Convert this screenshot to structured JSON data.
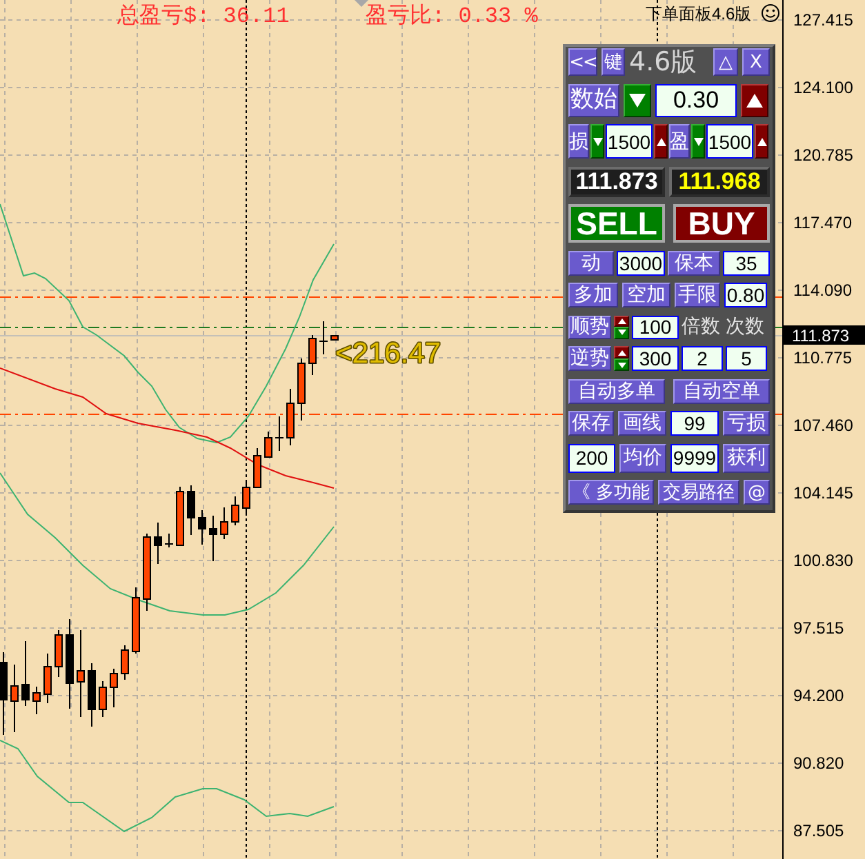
{
  "header": {
    "total_profit": "总盈亏$: 36.11",
    "profit_ratio": "盈亏比: 0.33 %",
    "panel_name": "下单面板4.6版"
  },
  "chart": {
    "price_axis": [
      "127.415",
      "124.100",
      "120.785",
      "117.470",
      "114.090",
      "110.775",
      "107.460",
      "104.145",
      "100.830",
      "97.515",
      "94.200",
      "90.820",
      "87.505"
    ],
    "current_price": "111.873",
    "line_label": "<216.47"
  },
  "panel": {
    "rows": [
      [
        {
          "kind": "button",
          "label": "<<"
        },
        {
          "kind": "button",
          "label": "键"
        },
        {
          "kind": "caption",
          "text": "4.6版"
        },
        {
          "kind": "button",
          "label": "△"
        },
        {
          "kind": "button",
          "label": "X"
        }
      ],
      [
        {
          "kind": "button",
          "label": "数始"
        },
        {
          "kind": "down"
        },
        {
          "kind": "field",
          "value": "0.30"
        },
        {
          "kind": "up"
        }
      ],
      [
        {
          "kind": "button",
          "label": "损"
        },
        {
          "kind": "down"
        },
        {
          "kind": "field",
          "value": "1500"
        },
        {
          "kind": "up"
        },
        {
          "kind": "button",
          "label": "盈"
        },
        {
          "kind": "down"
        },
        {
          "kind": "field",
          "value": "1500"
        },
        {
          "kind": "up"
        }
      ],
      [
        {
          "kind": "display",
          "value": "111.873",
          "color": "#ffffff"
        },
        {
          "kind": "display",
          "value": "111.968",
          "color": "#ffff00"
        }
      ],
      [
        {
          "kind": "order",
          "label": "SELL",
          "color": "#008000"
        },
        {
          "kind": "order",
          "label": "BUY",
          "color": "#800000"
        }
      ],
      [
        {
          "kind": "button",
          "label": "动"
        },
        {
          "kind": "field",
          "value": "3000"
        },
        {
          "kind": "button",
          "label": "保本"
        },
        {
          "kind": "field",
          "value": "35"
        }
      ],
      [
        {
          "kind": "button",
          "label": "多加"
        },
        {
          "kind": "button",
          "label": "空加"
        },
        {
          "kind": "button",
          "label": "手限"
        },
        {
          "kind": "field",
          "value": "0.80"
        }
      ],
      [
        {
          "kind": "button",
          "label": "顺势"
        },
        {
          "kind": "spinner"
        },
        {
          "kind": "field",
          "value": "100"
        },
        {
          "kind": "caption",
          "text": "倍数"
        },
        {
          "kind": "caption",
          "text": "次数"
        }
      ],
      [
        {
          "kind": "button",
          "label": "逆势"
        },
        {
          "kind": "spinner"
        },
        {
          "kind": "field",
          "value": "300"
        },
        {
          "kind": "field",
          "value": "2"
        },
        {
          "kind": "field",
          "value": "5"
        }
      ],
      [
        {
          "kind": "button",
          "label": "自动多单"
        },
        {
          "kind": "button",
          "label": "自动空单"
        }
      ],
      [
        {
          "kind": "button",
          "label": "保存"
        },
        {
          "kind": "button",
          "label": "画线"
        },
        {
          "kind": "field",
          "value": "99"
        },
        {
          "kind": "button",
          "label": "亏损"
        }
      ],
      [
        {
          "kind": "field",
          "value": "200"
        },
        {
          "kind": "button",
          "label": "均价"
        },
        {
          "kind": "field",
          "value": "9999"
        },
        {
          "kind": "button",
          "label": "获利"
        }
      ],
      [
        {
          "kind": "button",
          "label": "《 多功能"
        },
        {
          "kind": "button",
          "label": "交易路径"
        },
        {
          "kind": "button",
          "label": "@"
        }
      ]
    ]
  }
}
